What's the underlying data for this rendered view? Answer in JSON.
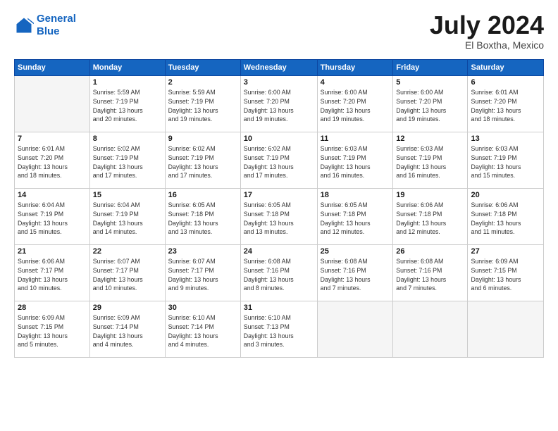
{
  "header": {
    "logo_line1": "General",
    "logo_line2": "Blue",
    "month": "July 2024",
    "location": "El Boxtha, Mexico"
  },
  "weekdays": [
    "Sunday",
    "Monday",
    "Tuesday",
    "Wednesday",
    "Thursday",
    "Friday",
    "Saturday"
  ],
  "weeks": [
    [
      {
        "day": "",
        "info": ""
      },
      {
        "day": "1",
        "info": "Sunrise: 5:59 AM\nSunset: 7:19 PM\nDaylight: 13 hours\nand 20 minutes."
      },
      {
        "day": "2",
        "info": "Sunrise: 5:59 AM\nSunset: 7:19 PM\nDaylight: 13 hours\nand 19 minutes."
      },
      {
        "day": "3",
        "info": "Sunrise: 6:00 AM\nSunset: 7:20 PM\nDaylight: 13 hours\nand 19 minutes."
      },
      {
        "day": "4",
        "info": "Sunrise: 6:00 AM\nSunset: 7:20 PM\nDaylight: 13 hours\nand 19 minutes."
      },
      {
        "day": "5",
        "info": "Sunrise: 6:00 AM\nSunset: 7:20 PM\nDaylight: 13 hours\nand 19 minutes."
      },
      {
        "day": "6",
        "info": "Sunrise: 6:01 AM\nSunset: 7:20 PM\nDaylight: 13 hours\nand 18 minutes."
      }
    ],
    [
      {
        "day": "7",
        "info": "Sunrise: 6:01 AM\nSunset: 7:20 PM\nDaylight: 13 hours\nand 18 minutes."
      },
      {
        "day": "8",
        "info": "Sunrise: 6:02 AM\nSunset: 7:19 PM\nDaylight: 13 hours\nand 17 minutes."
      },
      {
        "day": "9",
        "info": "Sunrise: 6:02 AM\nSunset: 7:19 PM\nDaylight: 13 hours\nand 17 minutes."
      },
      {
        "day": "10",
        "info": "Sunrise: 6:02 AM\nSunset: 7:19 PM\nDaylight: 13 hours\nand 17 minutes."
      },
      {
        "day": "11",
        "info": "Sunrise: 6:03 AM\nSunset: 7:19 PM\nDaylight: 13 hours\nand 16 minutes."
      },
      {
        "day": "12",
        "info": "Sunrise: 6:03 AM\nSunset: 7:19 PM\nDaylight: 13 hours\nand 16 minutes."
      },
      {
        "day": "13",
        "info": "Sunrise: 6:03 AM\nSunset: 7:19 PM\nDaylight: 13 hours\nand 15 minutes."
      }
    ],
    [
      {
        "day": "14",
        "info": "Sunrise: 6:04 AM\nSunset: 7:19 PM\nDaylight: 13 hours\nand 15 minutes."
      },
      {
        "day": "15",
        "info": "Sunrise: 6:04 AM\nSunset: 7:19 PM\nDaylight: 13 hours\nand 14 minutes."
      },
      {
        "day": "16",
        "info": "Sunrise: 6:05 AM\nSunset: 7:18 PM\nDaylight: 13 hours\nand 13 minutes."
      },
      {
        "day": "17",
        "info": "Sunrise: 6:05 AM\nSunset: 7:18 PM\nDaylight: 13 hours\nand 13 minutes."
      },
      {
        "day": "18",
        "info": "Sunrise: 6:05 AM\nSunset: 7:18 PM\nDaylight: 13 hours\nand 12 minutes."
      },
      {
        "day": "19",
        "info": "Sunrise: 6:06 AM\nSunset: 7:18 PM\nDaylight: 13 hours\nand 12 minutes."
      },
      {
        "day": "20",
        "info": "Sunrise: 6:06 AM\nSunset: 7:18 PM\nDaylight: 13 hours\nand 11 minutes."
      }
    ],
    [
      {
        "day": "21",
        "info": "Sunrise: 6:06 AM\nSunset: 7:17 PM\nDaylight: 13 hours\nand 10 minutes."
      },
      {
        "day": "22",
        "info": "Sunrise: 6:07 AM\nSunset: 7:17 PM\nDaylight: 13 hours\nand 10 minutes."
      },
      {
        "day": "23",
        "info": "Sunrise: 6:07 AM\nSunset: 7:17 PM\nDaylight: 13 hours\nand 9 minutes."
      },
      {
        "day": "24",
        "info": "Sunrise: 6:08 AM\nSunset: 7:16 PM\nDaylight: 13 hours\nand 8 minutes."
      },
      {
        "day": "25",
        "info": "Sunrise: 6:08 AM\nSunset: 7:16 PM\nDaylight: 13 hours\nand 7 minutes."
      },
      {
        "day": "26",
        "info": "Sunrise: 6:08 AM\nSunset: 7:16 PM\nDaylight: 13 hours\nand 7 minutes."
      },
      {
        "day": "27",
        "info": "Sunrise: 6:09 AM\nSunset: 7:15 PM\nDaylight: 13 hours\nand 6 minutes."
      }
    ],
    [
      {
        "day": "28",
        "info": "Sunrise: 6:09 AM\nSunset: 7:15 PM\nDaylight: 13 hours\nand 5 minutes."
      },
      {
        "day": "29",
        "info": "Sunrise: 6:09 AM\nSunset: 7:14 PM\nDaylight: 13 hours\nand 4 minutes."
      },
      {
        "day": "30",
        "info": "Sunrise: 6:10 AM\nSunset: 7:14 PM\nDaylight: 13 hours\nand 4 minutes."
      },
      {
        "day": "31",
        "info": "Sunrise: 6:10 AM\nSunset: 7:13 PM\nDaylight: 13 hours\nand 3 minutes."
      },
      {
        "day": "",
        "info": ""
      },
      {
        "day": "",
        "info": ""
      },
      {
        "day": "",
        "info": ""
      }
    ]
  ]
}
